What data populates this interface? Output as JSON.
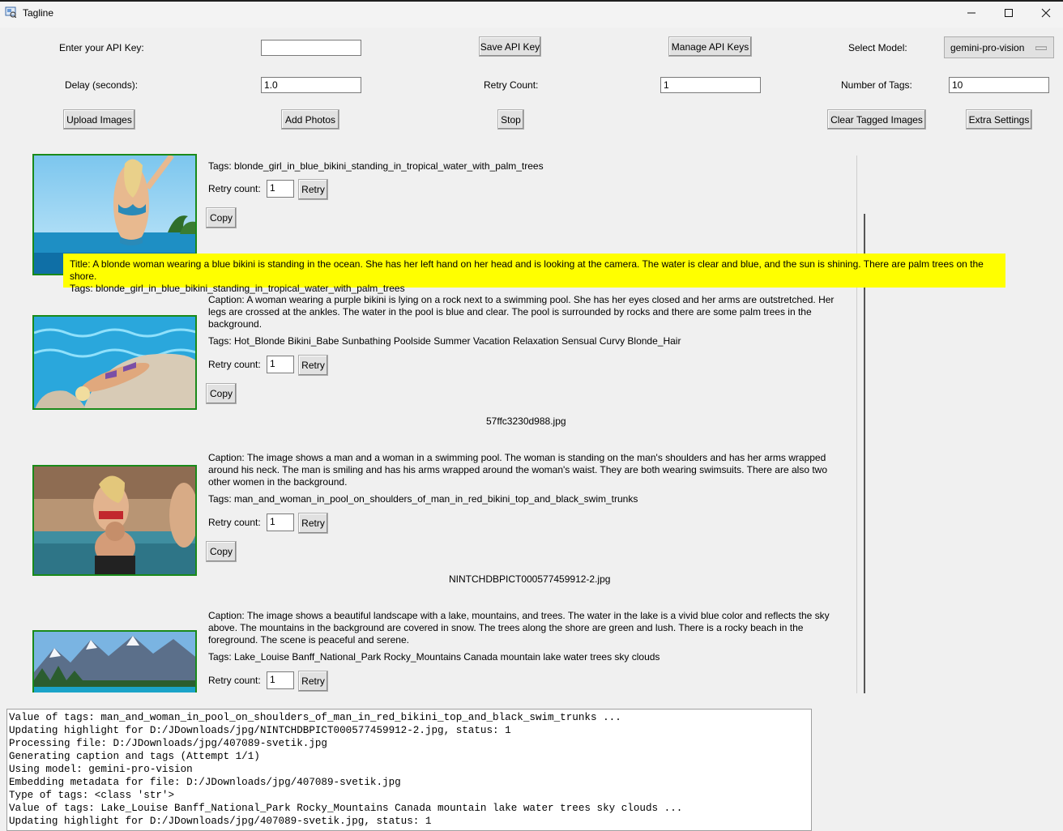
{
  "window": {
    "title": "Tagline"
  },
  "controls": {
    "api_key_label": "Enter your API Key:",
    "api_key_value": "",
    "save_api_key": "Save API Key",
    "manage_api_keys": "Manage API Keys",
    "select_model_label": "Select Model:",
    "model_value": "gemini-pro-vision",
    "delay_label": "Delay (seconds):",
    "delay_value": "1.0",
    "retry_count_label": "Retry Count:",
    "retry_count_value": "1",
    "num_tags_label": "Number of Tags:",
    "num_tags_value": "10",
    "upload_images": "Upload Images",
    "add_photos": "Add Photos",
    "stop": "Stop",
    "clear_tagged": "Clear Tagged Images",
    "extra_settings": "Extra Settings"
  },
  "items": [
    {
      "tags": "Tags: blonde_girl_in_blue_bikini_standing_in_tropical_water_with_palm_trees",
      "retry_label": "Retry count:",
      "retry_value": "1",
      "retry_btn": "Retry",
      "copy_btn": "Copy"
    },
    {
      "caption": "Caption:  A woman wearing a purple bikini is lying on a rock next to a swimming pool. She has her eyes closed and her arms are outstretched. Her legs are crossed at the ankles. The water in the pool is blue and clear. The pool is surrounded by rocks and there are some palm trees in the background.",
      "tags": "Tags: Hot_Blonde Bikini_Babe Sunbathing Poolside Summer Vacation Relaxation Sensual Curvy Blonde_Hair",
      "retry_label": "Retry count:",
      "retry_value": "1",
      "retry_btn": "Retry",
      "copy_btn": "Copy",
      "filename": "57ffc3230d988.jpg"
    },
    {
      "caption": "Caption:  The image shows a man and a woman in a swimming pool. The woman is standing on the man's shoulders and has her arms wrapped around his neck. The man is smiling and has his arms wrapped around the woman's waist. They are both wearing swimsuits. There are also two other women in the background.",
      "tags": "Tags: man_and_woman_in_pool_on_shoulders_of_man_in_red_bikini_top_and_black_swim_trunks",
      "retry_label": "Retry count:",
      "retry_value": "1",
      "retry_btn": "Retry",
      "copy_btn": "Copy",
      "filename": "NINTCHDBPICT000577459912-2.jpg"
    },
    {
      "caption": "Caption:  The image shows a beautiful landscape with a lake, mountains, and trees. The water in the lake is a vivid blue color and reflects the sky above. The mountains in the background are covered in snow. The trees along the shore are green and lush. There is a rocky beach in the foreground. The scene is peaceful and serene.",
      "tags": "Tags: Lake_Louise Banff_National_Park Rocky_Mountains Canada mountain lake water trees sky clouds",
      "retry_label": "Retry count:",
      "retry_value": "1",
      "retry_btn": "Retry"
    }
  ],
  "tooltip": {
    "title": "Title:  A blonde woman wearing a blue bikini is standing in the ocean. She has her left hand on her head and is looking at the camera. The water is clear and blue, and the sun is shining. There are palm trees on the shore.",
    "tags": "Tags: blonde_girl_in_blue_bikini_standing_in_tropical_water_with_palm_trees"
  },
  "log": [
    "Value of tags: man_and_woman_in_pool_on_shoulders_of_man_in_red_bikini_top_and_black_swim_trunks ...",
    "Updating highlight for D:/JDownloads/jpg/NINTCHDBPICT000577459912-2.jpg, status: 1",
    "Processing file: D:/JDownloads/jpg/407089-svetik.jpg",
    "Generating caption and tags (Attempt 1/1)",
    "Using model: gemini-pro-vision",
    "Embedding metadata for file: D:/JDownloads/jpg/407089-svetik.jpg",
    "Type of tags: <class 'str'>",
    "Value of tags: Lake_Louise Banff_National_Park Rocky_Mountains Canada mountain lake water trees sky clouds ...",
    "Updating highlight for D:/JDownloads/jpg/407089-svetik.jpg, status: 1"
  ]
}
